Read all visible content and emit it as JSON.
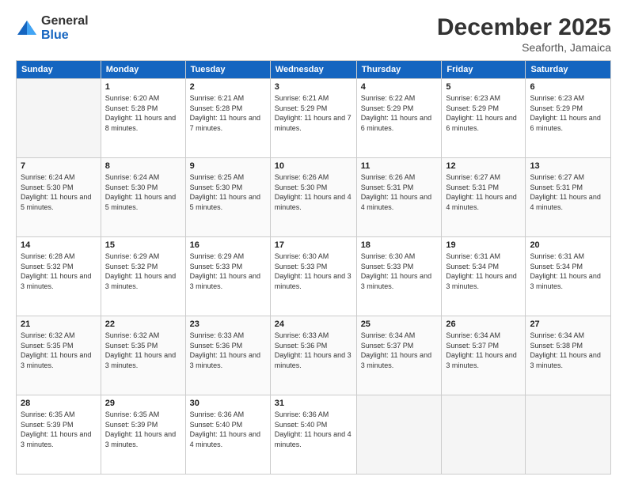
{
  "logo": {
    "general": "General",
    "blue": "Blue"
  },
  "header": {
    "month": "December 2025",
    "location": "Seaforth, Jamaica"
  },
  "weekdays": [
    "Sunday",
    "Monday",
    "Tuesday",
    "Wednesday",
    "Thursday",
    "Friday",
    "Saturday"
  ],
  "weeks": [
    [
      {
        "num": "",
        "empty": true
      },
      {
        "num": "1",
        "sunrise": "6:20 AM",
        "sunset": "5:28 PM",
        "daylight": "11 hours and 8 minutes."
      },
      {
        "num": "2",
        "sunrise": "6:21 AM",
        "sunset": "5:28 PM",
        "daylight": "11 hours and 7 minutes."
      },
      {
        "num": "3",
        "sunrise": "6:21 AM",
        "sunset": "5:29 PM",
        "daylight": "11 hours and 7 minutes."
      },
      {
        "num": "4",
        "sunrise": "6:22 AM",
        "sunset": "5:29 PM",
        "daylight": "11 hours and 6 minutes."
      },
      {
        "num": "5",
        "sunrise": "6:23 AM",
        "sunset": "5:29 PM",
        "daylight": "11 hours and 6 minutes."
      },
      {
        "num": "6",
        "sunrise": "6:23 AM",
        "sunset": "5:29 PM",
        "daylight": "11 hours and 6 minutes."
      }
    ],
    [
      {
        "num": "7",
        "sunrise": "6:24 AM",
        "sunset": "5:30 PM",
        "daylight": "11 hours and 5 minutes."
      },
      {
        "num": "8",
        "sunrise": "6:24 AM",
        "sunset": "5:30 PM",
        "daylight": "11 hours and 5 minutes."
      },
      {
        "num": "9",
        "sunrise": "6:25 AM",
        "sunset": "5:30 PM",
        "daylight": "11 hours and 5 minutes."
      },
      {
        "num": "10",
        "sunrise": "6:26 AM",
        "sunset": "5:30 PM",
        "daylight": "11 hours and 4 minutes."
      },
      {
        "num": "11",
        "sunrise": "6:26 AM",
        "sunset": "5:31 PM",
        "daylight": "11 hours and 4 minutes."
      },
      {
        "num": "12",
        "sunrise": "6:27 AM",
        "sunset": "5:31 PM",
        "daylight": "11 hours and 4 minutes."
      },
      {
        "num": "13",
        "sunrise": "6:27 AM",
        "sunset": "5:31 PM",
        "daylight": "11 hours and 4 minutes."
      }
    ],
    [
      {
        "num": "14",
        "sunrise": "6:28 AM",
        "sunset": "5:32 PM",
        "daylight": "11 hours and 3 minutes."
      },
      {
        "num": "15",
        "sunrise": "6:29 AM",
        "sunset": "5:32 PM",
        "daylight": "11 hours and 3 minutes."
      },
      {
        "num": "16",
        "sunrise": "6:29 AM",
        "sunset": "5:33 PM",
        "daylight": "11 hours and 3 minutes."
      },
      {
        "num": "17",
        "sunrise": "6:30 AM",
        "sunset": "5:33 PM",
        "daylight": "11 hours and 3 minutes."
      },
      {
        "num": "18",
        "sunrise": "6:30 AM",
        "sunset": "5:33 PM",
        "daylight": "11 hours and 3 minutes."
      },
      {
        "num": "19",
        "sunrise": "6:31 AM",
        "sunset": "5:34 PM",
        "daylight": "11 hours and 3 minutes."
      },
      {
        "num": "20",
        "sunrise": "6:31 AM",
        "sunset": "5:34 PM",
        "daylight": "11 hours and 3 minutes."
      }
    ],
    [
      {
        "num": "21",
        "sunrise": "6:32 AM",
        "sunset": "5:35 PM",
        "daylight": "11 hours and 3 minutes."
      },
      {
        "num": "22",
        "sunrise": "6:32 AM",
        "sunset": "5:35 PM",
        "daylight": "11 hours and 3 minutes."
      },
      {
        "num": "23",
        "sunrise": "6:33 AM",
        "sunset": "5:36 PM",
        "daylight": "11 hours and 3 minutes."
      },
      {
        "num": "24",
        "sunrise": "6:33 AM",
        "sunset": "5:36 PM",
        "daylight": "11 hours and 3 minutes."
      },
      {
        "num": "25",
        "sunrise": "6:34 AM",
        "sunset": "5:37 PM",
        "daylight": "11 hours and 3 minutes."
      },
      {
        "num": "26",
        "sunrise": "6:34 AM",
        "sunset": "5:37 PM",
        "daylight": "11 hours and 3 minutes."
      },
      {
        "num": "27",
        "sunrise": "6:34 AM",
        "sunset": "5:38 PM",
        "daylight": "11 hours and 3 minutes."
      }
    ],
    [
      {
        "num": "28",
        "sunrise": "6:35 AM",
        "sunset": "5:39 PM",
        "daylight": "11 hours and 3 minutes."
      },
      {
        "num": "29",
        "sunrise": "6:35 AM",
        "sunset": "5:39 PM",
        "daylight": "11 hours and 3 minutes."
      },
      {
        "num": "30",
        "sunrise": "6:36 AM",
        "sunset": "5:40 PM",
        "daylight": "11 hours and 4 minutes."
      },
      {
        "num": "31",
        "sunrise": "6:36 AM",
        "sunset": "5:40 PM",
        "daylight": "11 hours and 4 minutes."
      },
      {
        "num": "",
        "empty": true
      },
      {
        "num": "",
        "empty": true
      },
      {
        "num": "",
        "empty": true
      }
    ]
  ]
}
